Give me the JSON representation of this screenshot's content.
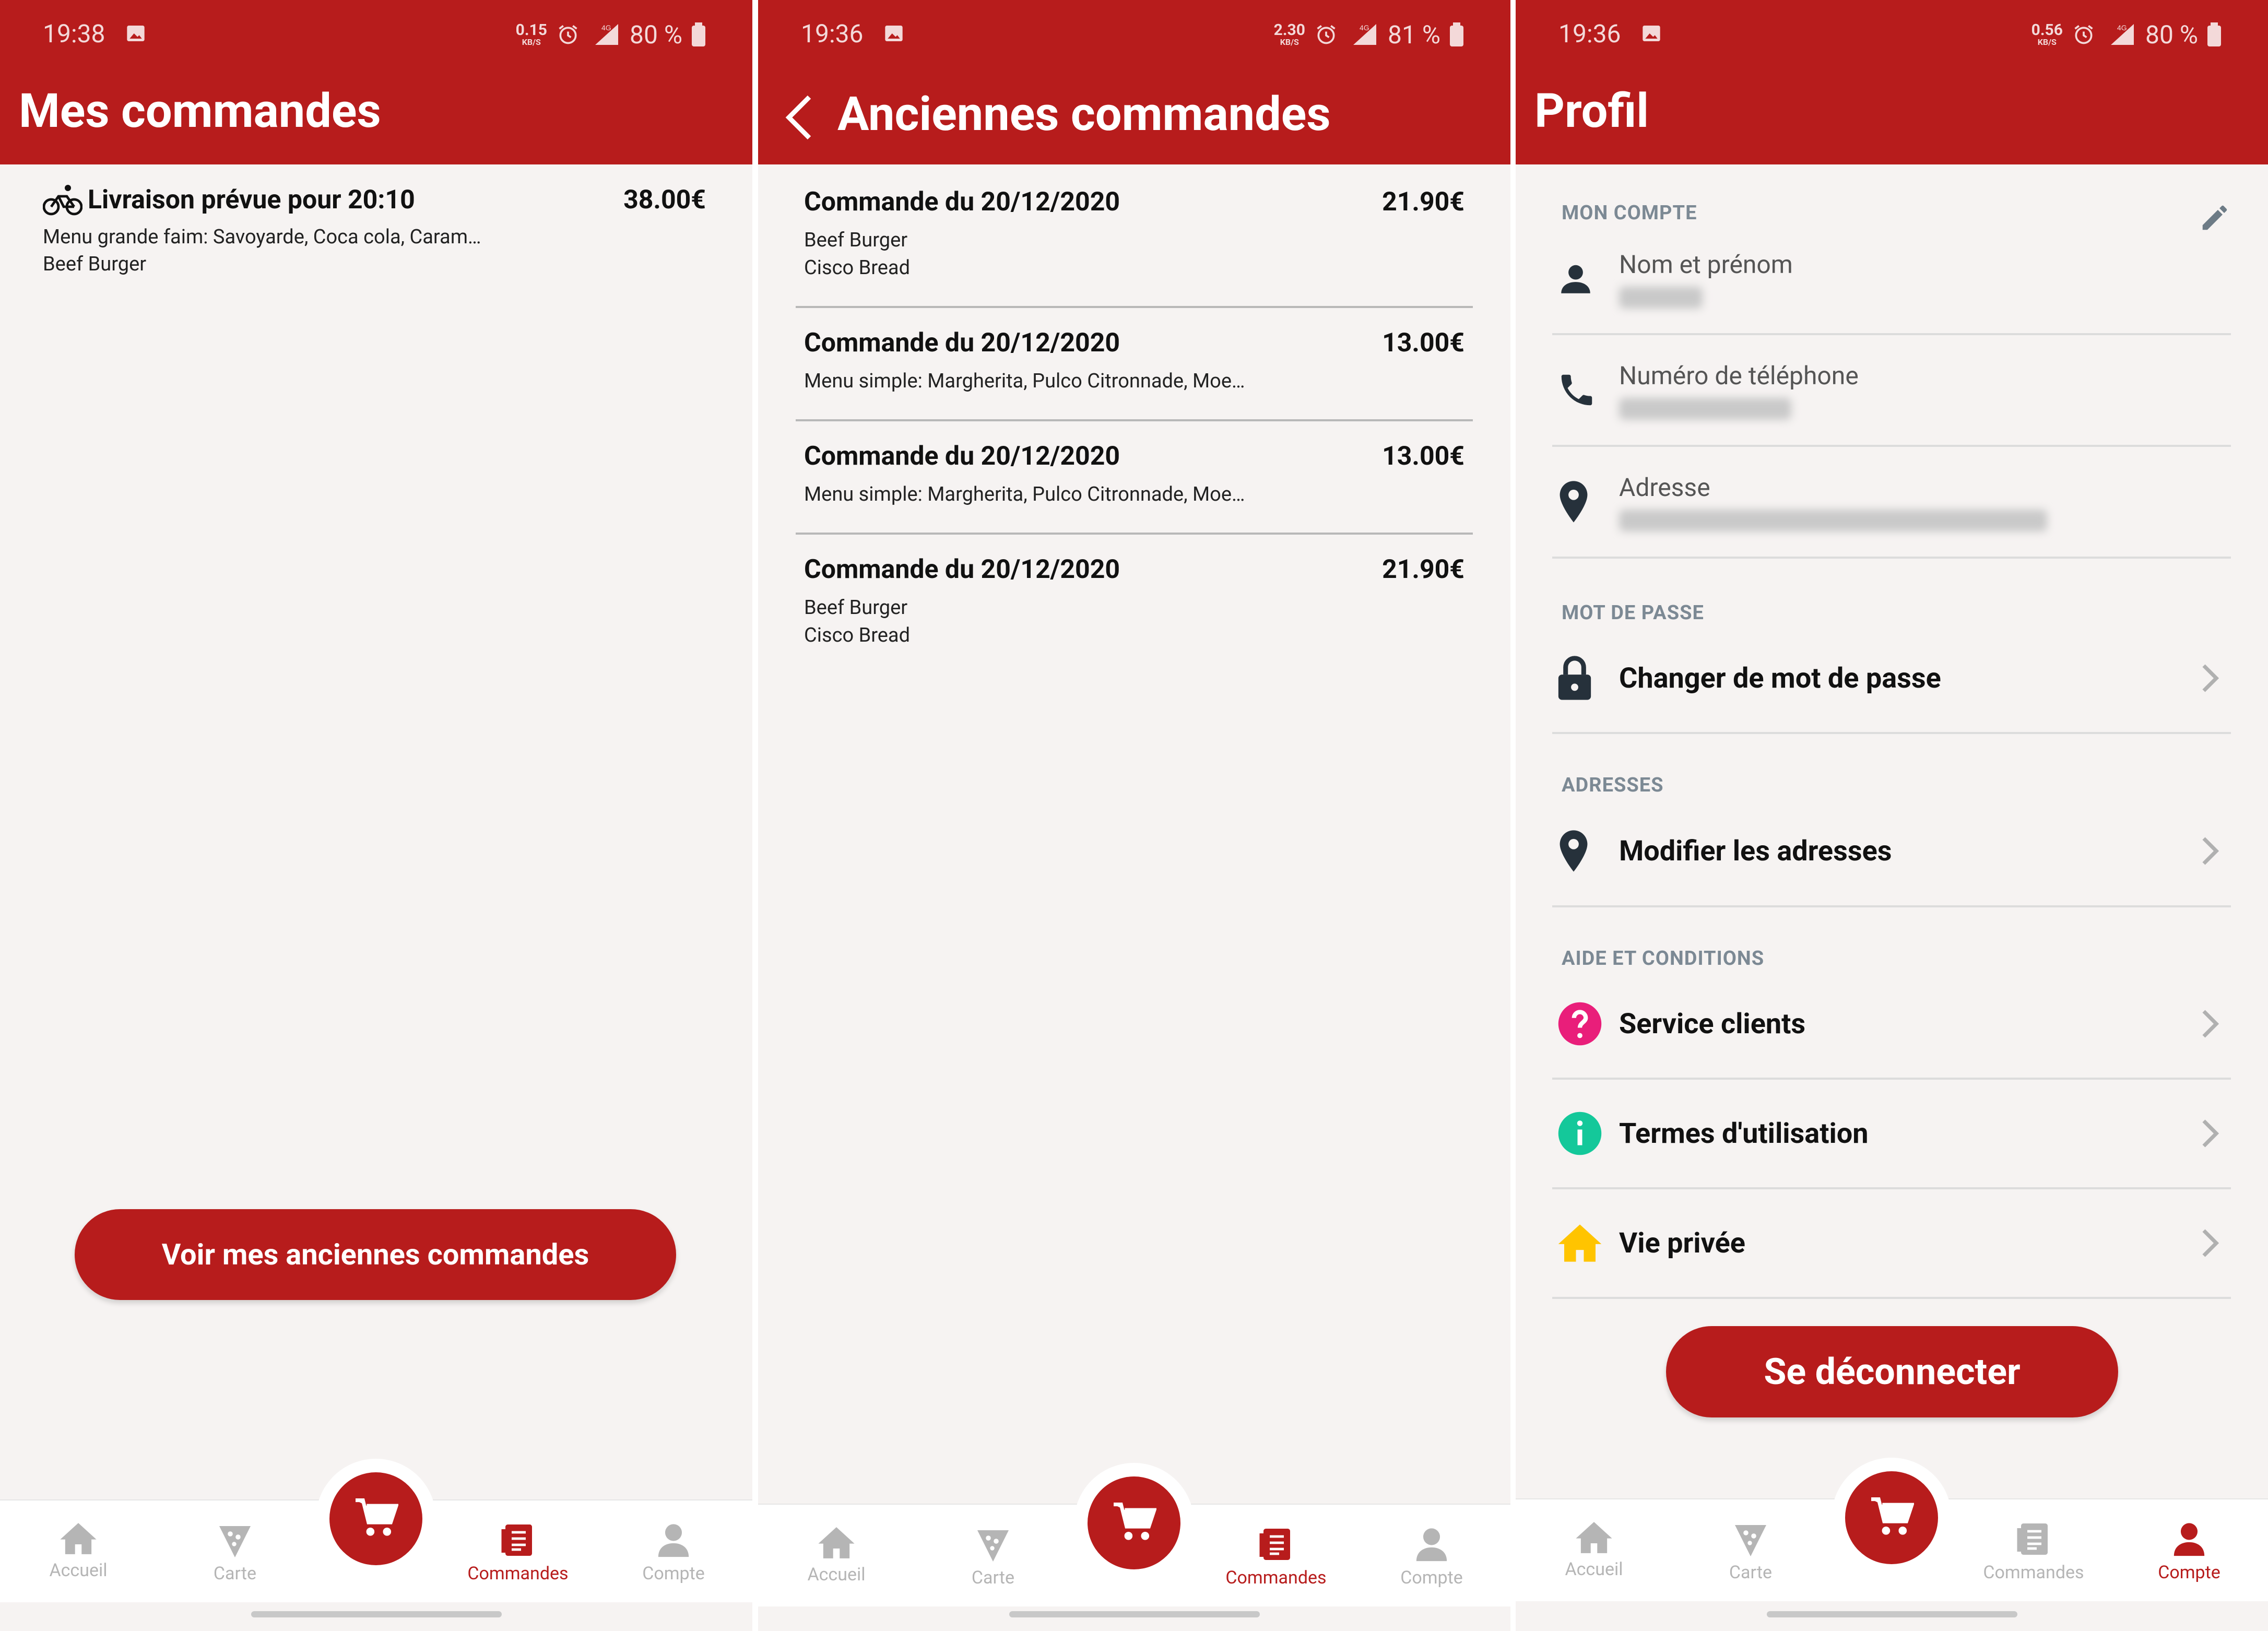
{
  "colors": {
    "brand": "#b71c1c",
    "background": "#f6f3f2",
    "inactive_nav": "#b5b5b5"
  },
  "nav_labels": {
    "home": "Accueil",
    "menu": "Carte",
    "orders": "Commandes",
    "account": "Compte"
  },
  "screens": [
    {
      "status": {
        "time": "19:38",
        "speed_value": "0.15",
        "speed_unit": "KB/S",
        "battery": "80 %"
      },
      "title": "Mes commandes",
      "current_order": {
        "title": "Livraison prévue pour 20:10",
        "price": "38.00€",
        "lines": [
          "Menu grande faim: Savoyarde, Coca cola, Caram…",
          "Beef Burger"
        ]
      },
      "button_label": "Voir mes anciennes commandes",
      "active_tab": "orders"
    },
    {
      "status": {
        "time": "19:36",
        "speed_value": "2.30",
        "speed_unit": "KB/S",
        "battery": "81 %"
      },
      "title": "Anciennes commandes",
      "orders": [
        {
          "title": "Commande du 20/12/2020",
          "price": "21.90€",
          "lines": [
            "Beef Burger",
            "Cisco Bread"
          ]
        },
        {
          "title": "Commande du 20/12/2020",
          "price": "13.00€",
          "lines": [
            "Menu simple: Margherita, Pulco Citronnade, Moe…"
          ]
        },
        {
          "title": "Commande du 20/12/2020",
          "price": "13.00€",
          "lines": [
            "Menu simple: Margherita, Pulco Citronnade, Moe…"
          ]
        },
        {
          "title": "Commande du 20/12/2020",
          "price": "21.90€",
          "lines": [
            "Beef Burger",
            "Cisco Bread"
          ]
        }
      ],
      "active_tab": "orders"
    },
    {
      "status": {
        "time": "19:36",
        "speed_value": "0.56",
        "speed_unit": "KB/S",
        "battery": "80 %"
      },
      "title": "Profil",
      "sections": {
        "account": "MON COMPTE",
        "password": "MOT DE PASSE",
        "addresses": "ADRESSES",
        "help": "AIDE ET CONDITIONS"
      },
      "fields": {
        "name": "Nom et prénom",
        "phone": "Numéro de téléphone",
        "address": "Adresse"
      },
      "rows": {
        "change_password": "Changer de mot de passe",
        "edit_addresses": "Modifier les adresses",
        "customer_service": "Service clients",
        "terms": "Termes d'utilisation",
        "privacy": "Vie privée"
      },
      "logout_label": "Se déconnecter",
      "active_tab": "account"
    }
  ]
}
